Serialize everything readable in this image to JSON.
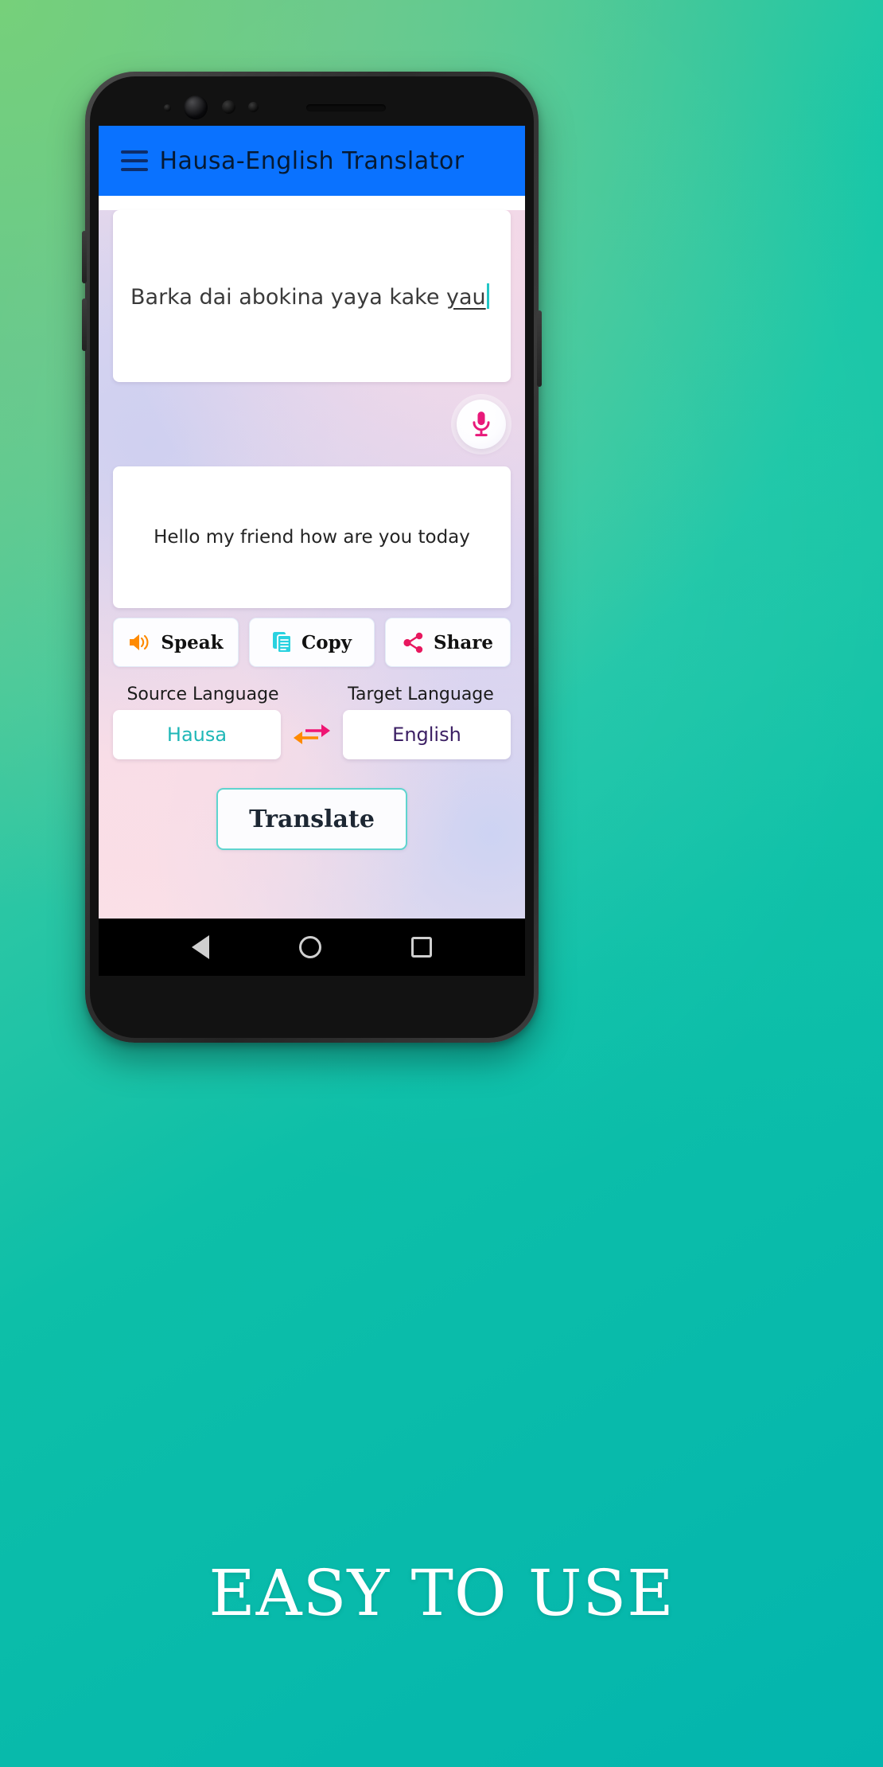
{
  "promo": {
    "caption": "EASY TO USE",
    "bg_color_start": "#7cd07c",
    "bg_color_end": "#03b5ae"
  },
  "app": {
    "appbar": {
      "title": "Hausa-English Translator",
      "bg_color": "#0a72ff",
      "menu_icon": "hamburger-menu-icon"
    },
    "input": {
      "text_before": "Barka dai abokina yaya kake ",
      "text_misspelled": "yau",
      "caret_color": "#22c6c6"
    },
    "mic": {
      "icon": "microphone-icon",
      "icon_color": "#e8197a"
    },
    "output": {
      "text": "Hello my friend how are you today"
    },
    "actions": [
      {
        "label": "Speak",
        "icon": "speaker-volume-icon",
        "icon_color": "#ff8a00"
      },
      {
        "label": "Copy",
        "icon": "copy-documents-icon",
        "icon_color": "#2ad2e0"
      },
      {
        "label": "Share",
        "icon": "share-nodes-icon",
        "icon_color": "#e8185f"
      }
    ],
    "languages": {
      "source_label": "Source Language",
      "target_label": "Target Language",
      "source_value": "Hausa",
      "target_value": "English",
      "source_color": "#1fb7b7",
      "target_color": "#3c2064",
      "swap_icon": "swap-arrows-icon",
      "swap_left_color": "#ff8a00",
      "swap_right_color": "#ef1573"
    },
    "translate_label": "Translate",
    "navbar": {
      "back": "back-triangle-icon",
      "home": "home-circle-icon",
      "recent": "recents-square-icon"
    }
  }
}
